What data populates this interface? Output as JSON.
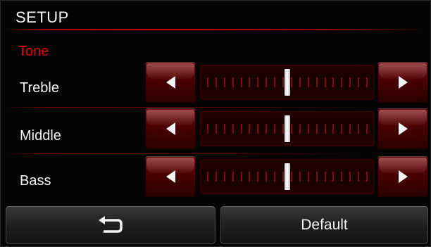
{
  "header": {
    "title": "SETUP"
  },
  "section": {
    "title": "Tone"
  },
  "rows": [
    {
      "label": "Treble",
      "level": 0.5,
      "tick_count": 20
    },
    {
      "label": "Middle",
      "level": 0.5,
      "tick_count": 20
    },
    {
      "label": "Bass",
      "level": 0.5,
      "tick_count": 20
    }
  ],
  "footer": {
    "back_icon": "return-arrow-icon",
    "default_label": "Default"
  },
  "colors": {
    "accent": "#e20000",
    "panel": "#050505",
    "text": "#f2f2f2"
  }
}
